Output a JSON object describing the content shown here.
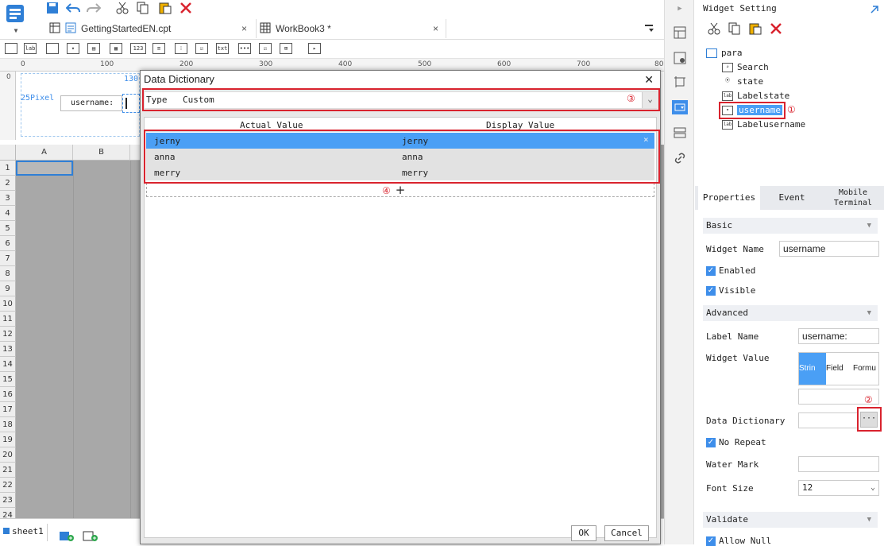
{
  "toolbar": {
    "tabs": [
      {
        "label": "GettingStartedEN.cpt",
        "close": "×"
      },
      {
        "label": "WorkBook3 *",
        "close": "×"
      }
    ]
  },
  "ruler": {
    "ticks": [
      "0",
      "100",
      "200",
      "300",
      "400",
      "500",
      "600",
      "700",
      "80"
    ],
    "vtick": "0"
  },
  "form": {
    "pixel_label": "25Pixel",
    "marker": "130",
    "username_label": "username:"
  },
  "sheet": {
    "columns": [
      "A",
      "B"
    ],
    "rows": [
      "1",
      "2",
      "3",
      "4",
      "5",
      "6",
      "7",
      "8",
      "9",
      "10",
      "11",
      "12",
      "13",
      "14",
      "15",
      "16",
      "17",
      "18",
      "19",
      "20",
      "21",
      "22",
      "23",
      "24"
    ],
    "sheet_tab": "sheet1"
  },
  "dialog": {
    "title": "Data Dictionary",
    "close": "✕",
    "type_label": "Type",
    "type_value": "Custom",
    "col_actual": "Actual Value",
    "col_display": "Display Value",
    "rows": [
      {
        "actual": "jerny",
        "display": "jerny"
      },
      {
        "actual": "anna",
        "display": "anna"
      },
      {
        "actual": "merry",
        "display": "merry"
      }
    ],
    "row_delete": "×",
    "add": "+",
    "ok": "OK",
    "cancel": "Cancel"
  },
  "annotations": {
    "n1": "①",
    "n2": "②",
    "n3": "③",
    "n4": "④"
  },
  "panel": {
    "title": "Widget Setting",
    "tree": {
      "root": "para",
      "items": [
        "Search",
        "state",
        "Labelstate",
        "username",
        "Labelusername"
      ]
    },
    "tabs": [
      "Properties",
      "Event",
      "Mobile Terminal"
    ],
    "sections": {
      "basic": "Basic",
      "advanced": "Advanced",
      "validate": "Validate"
    },
    "widget_name_label": "Widget Name",
    "widget_name_value": "username",
    "enabled": "Enabled",
    "visible": "Visible",
    "label_name_label": "Label Name",
    "label_name_value": "username:",
    "widget_value_label": "Widget Value",
    "widget_value_tabs": [
      "Strin",
      "Field",
      "Formu"
    ],
    "data_dictionary_label": "Data Dictionary",
    "dict_button": "···",
    "no_repeat": "No Repeat",
    "water_mark_label": "Water Mark",
    "font_size_label": "Font Size",
    "font_size_value": "12",
    "allow_null": "Allow Null"
  },
  "colors": {
    "accent": "#3e8eea",
    "annotation": "#d9232e",
    "selection": "#4a9ff5"
  }
}
